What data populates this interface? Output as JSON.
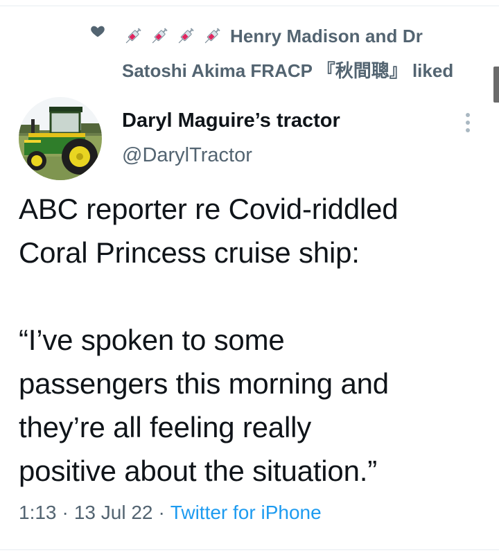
{
  "social_context": {
    "icon": "heart-icon",
    "emoji_icons": [
      "syringe-icon",
      "syringe-icon",
      "syringe-icon",
      "syringe-icon"
    ],
    "line1": "Henry Madison and Dr",
    "line2": "Satoshi Akima FRACP 『秋間聰』 liked"
  },
  "author": {
    "name": "Daryl Maguire’s tractor",
    "handle": "@DarylTractor",
    "avatar": "tractor-photo"
  },
  "tweet": {
    "paragraphs": [
      [
        "ABC reporter re Covid-riddled",
        "Coral Princess cruise ship:"
      ],
      [
        "“I’ve spoken to some",
        "passengers this morning and",
        "they’re all feeling really",
        "positive about the situation.”"
      ]
    ]
  },
  "meta": {
    "time": "1:13",
    "date": "13 Jul 22",
    "source": "Twitter for iPhone",
    "separator": "·"
  },
  "colors": {
    "text_primary": "#0f1419",
    "text_secondary": "#536471",
    "link": "#1d9bf0",
    "divider": "#e6ecf0"
  }
}
